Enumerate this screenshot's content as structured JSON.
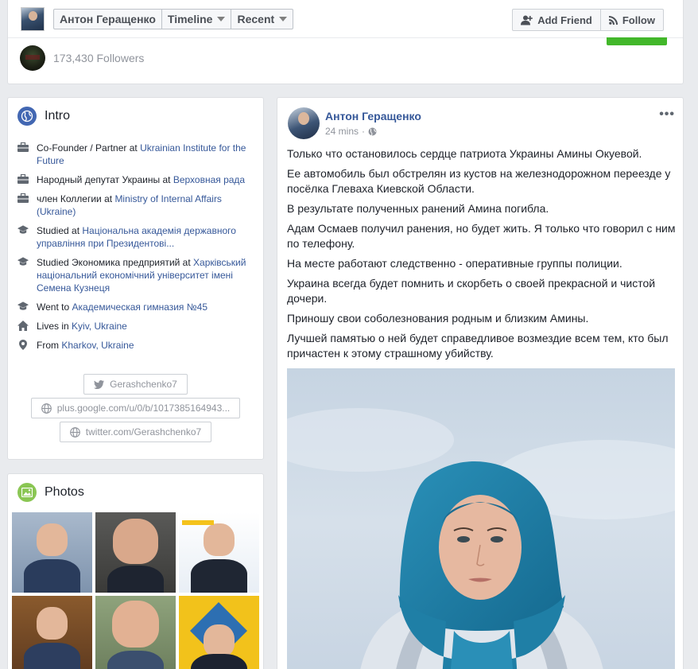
{
  "header": {
    "name": "Антон Геращенко",
    "nav": [
      {
        "label": "Timeline"
      },
      {
        "label": "Recent"
      }
    ],
    "add_friend_label": "Add Friend",
    "follow_label": "Follow",
    "followers_text": "173,430 Followers"
  },
  "intro": {
    "title": "Intro",
    "items": [
      {
        "icon": "briefcase-icon",
        "prefix": "Co-Founder / Partner at ",
        "link": "Ukrainian Institute for the Future"
      },
      {
        "icon": "briefcase-icon",
        "prefix": "Народный депутат Украины at ",
        "link": "Верховная рада"
      },
      {
        "icon": "briefcase-icon",
        "prefix": "член Коллегии at ",
        "link": "Ministry of Internal Affairs (Ukraine)"
      },
      {
        "icon": "graduation-cap-icon",
        "prefix": "Studied at ",
        "link": "Національна академія державного управління при Президентові..."
      },
      {
        "icon": "graduation-cap-icon",
        "prefix": "Studied Экономика предприятий at ",
        "link": "Харківський національний економічний університет імені Семена Кузнеця"
      },
      {
        "icon": "graduation-cap-icon",
        "prefix": "Went to ",
        "link": "Академическая гимназия №45"
      },
      {
        "icon": "home-icon",
        "prefix": "Lives in ",
        "link": "Kyiv, Ukraine"
      },
      {
        "icon": "location-pin-icon",
        "prefix": "From ",
        "link": "Kharkov, Ukraine"
      }
    ],
    "twitter_handle": "Gerashchenko7",
    "google_url": "plus.google.com/u/0/b/1017385164943...",
    "twitter_url": "twitter.com/Gerashchenko7"
  },
  "photos": {
    "title": "Photos"
  },
  "post": {
    "author": "Антон Геращенко",
    "time": "24 mins",
    "menu": "•••",
    "paragraphs": [
      "Только что остановилось сердце патриота Украины Амины Окуевой.",
      "Ее автомобиль был обстрелян из кустов на железнодорожном переезде у посёлка Глеваха Киевской Области.",
      "В результате полученных ранений Амина погибла.",
      "Адам Осмаев получил ранения, но будет жить. Я только что говорил с ним по телефону.",
      "На месте работают следственно - оперативные группы полиции.",
      "Украина всегда будет помнить и скорбеть о своей прекрасной и чистой дочери.",
      "Приношу свои соболезнования родным и близким Амины.",
      "Лучшей памятью о ней будет справедливое возмездие всем тем, кто был причастен к этому страшному убийству."
    ]
  },
  "colors": {
    "link": "#365899",
    "accent_green": "#42b72a",
    "intro_icon_bg": "#4267b2",
    "photos_icon_bg": "#8ac653",
    "hijab": "#1f7fa6"
  }
}
